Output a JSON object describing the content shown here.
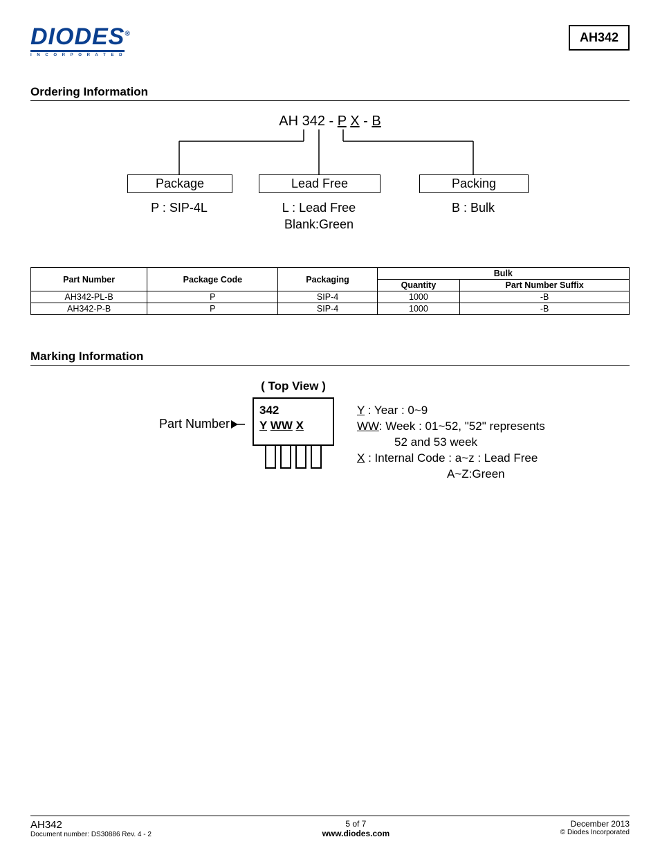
{
  "header": {
    "logo_text": "DIODES",
    "logo_sub": "I N C O R P O R A T E D",
    "part_number": "AH342"
  },
  "ordering": {
    "title": "Ordering Information",
    "code_prefix": "AH 342 - ",
    "code_p": "P",
    "code_x": "X",
    "code_sep1": " ",
    "code_sep2": " - ",
    "code_b": "B",
    "box_package": "Package",
    "box_leadfree": "Lead Free",
    "box_packing": "Packing",
    "lbl_p": "P : SIP-4L",
    "lbl_l1": "L : Lead Free",
    "lbl_l2": "Blank:Green",
    "lbl_b": "B : Bulk",
    "table": {
      "headers": {
        "pn": "Part Number",
        "pkgcode": "Package Code",
        "pkg": "Packaging",
        "bulk": "Bulk",
        "qty": "Quantity",
        "suffix": "Part Number Suffix"
      },
      "rows": [
        {
          "pn": "AH342-PL-B",
          "code": "P",
          "pkg": "SIP-4",
          "qty": "1000",
          "suffix": "-B"
        },
        {
          "pn": "AH342-P-B",
          "code": "P",
          "pkg": "SIP-4",
          "qty": "1000",
          "suffix": "-B"
        }
      ]
    }
  },
  "marking": {
    "title": "Marking Information",
    "topview": "( Top View )",
    "pn_label": "Part Number",
    "chip_line1": "342",
    "chip_y": "Y",
    "chip_ww": "WW",
    "chip_x": "X",
    "leg_y": "Y",
    "leg_y_txt": " : Year : 0~9",
    "leg_ww": "WW",
    "leg_ww_txt": ": Week : 01~52, \"52\" represents",
    "leg_ww_txt2": "52 and 53 week",
    "leg_x": "X",
    "leg_x_txt": " : Internal Code :  a~z : Lead Free",
    "leg_x_txt2": "A~Z:Green"
  },
  "footer": {
    "part": "AH342",
    "doc": "Document number: DS30886  Rev. 4 - 2",
    "page": "5 of 7",
    "url": "www.diodes.com",
    "date": "December 2013",
    "copy": "© Diodes Incorporated"
  }
}
